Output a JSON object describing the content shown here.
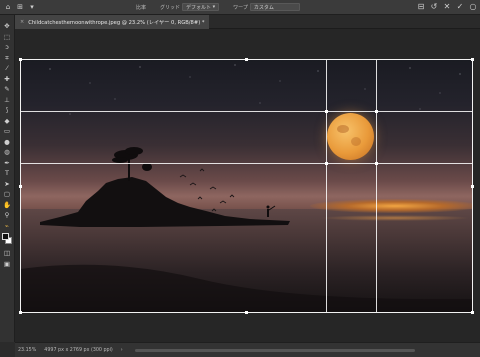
{
  "options_bar": {
    "ratio_label": "比率",
    "grid_label": "グリッド",
    "grid_value": "デフォルト",
    "warp_label": "ワープ",
    "warp_value": "カスタム"
  },
  "document": {
    "tab_title": "Childcatchesthemoonwithrope.jpeg @ 23.2% (レイヤー 0, RGB/8#) *",
    "close_glyph": "×"
  },
  "status": {
    "zoom": "23.15%",
    "doc_info": "4997 px x 2769 px (300 ppi)"
  },
  "toolbar": {
    "tools": [
      "move-tool",
      "marquee-tool",
      "lasso-tool",
      "crop-tool",
      "eyedropper-tool",
      "healing-tool",
      "brush-tool",
      "stamp-tool",
      "history-brush-tool",
      "eraser-tool",
      "gradient-tool",
      "blur-tool",
      "dodge-tool",
      "pen-tool",
      "type-tool",
      "path-select-tool",
      "shape-tool",
      "hand-tool",
      "zoom-tool",
      "edit-toolbar"
    ]
  },
  "colors": {
    "app_bg": "#2b2b2b",
    "panel": "#323232",
    "moon": "#e99a3a",
    "crop_frame": "#f2f2f2"
  }
}
